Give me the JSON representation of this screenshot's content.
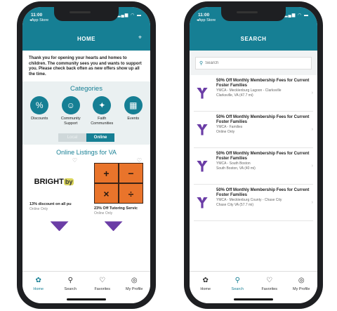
{
  "status": {
    "time": "11:00",
    "back_label": "App Store"
  },
  "home_screen": {
    "title": "HOME",
    "intro": "Thank you for opening your hearts and homes to children. The community sees you and wants to support you. Please check back often as new offers show up all the time.",
    "categories_title": "Categories",
    "categories": [
      {
        "label": "Discounts",
        "icon": "discount-tag-icon"
      },
      {
        "label": "Community Support",
        "icon": "people-icon"
      },
      {
        "label": "Faith Communities",
        "icon": "praying-hands-icon"
      },
      {
        "label": "Events",
        "icon": "calendar-icon"
      }
    ],
    "toggle": {
      "local": "Local",
      "online": "Online"
    },
    "listings_title": "Online Listings for VA",
    "listings": [
      {
        "title": "13% discount on all pu",
        "subtitle": "Online Only",
        "logo_text": "BRIGHT",
        "logo_badge": "by"
      },
      {
        "title": "23% Off Tutoring Servic",
        "subtitle": "Online Only"
      }
    ],
    "math_symbols": [
      "+",
      "−",
      "×",
      "÷"
    ]
  },
  "search_screen": {
    "title": "SEARCH",
    "placeholder": "Search",
    "results": [
      {
        "title": "50% Off Monthly Membership Fees for Current Foster Families",
        "org": "YMCA - Mecklenburg Lagoon - Clarksville",
        "location": "Clarksville, VA (47.7 mi)"
      },
      {
        "title": "50% Off Monthly Membership Fees for Current Foster Families",
        "org": "YMCA - Families",
        "location": "Online Only"
      },
      {
        "title": "50% Off Monthly Membership Fees for Current Foster Families",
        "org": "YMCA - South Boston",
        "location": "South Boston, VA (40 mi)"
      },
      {
        "title": "50% Off Monthly Membership Fees for Current Foster Families",
        "org": "YMCA - Mecklenburg County - Chase City",
        "location": "Chase City VA (57.7 mi)"
      }
    ]
  },
  "tabs": [
    {
      "label": "Home",
      "icon": "home-icon"
    },
    {
      "label": "Search",
      "icon": "search-icon"
    },
    {
      "label": "Favorites",
      "icon": "heart-icon"
    },
    {
      "label": "My Profile",
      "icon": "profile-icon"
    }
  ],
  "colors": {
    "primary": "#167f94",
    "ymca_purple": "#6b3da6",
    "math_orange": "#e9742b"
  }
}
